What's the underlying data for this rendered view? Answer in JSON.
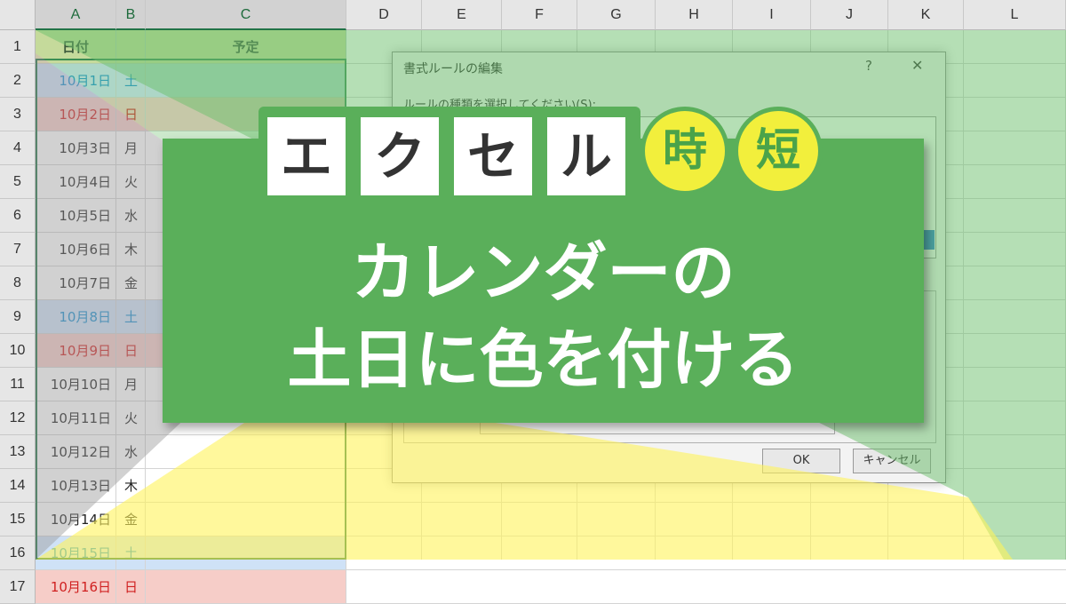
{
  "columns": [
    "A",
    "B",
    "C",
    "D",
    "E",
    "F",
    "G",
    "H",
    "I",
    "J",
    "K",
    "L"
  ],
  "rows": [
    "1",
    "2",
    "3",
    "4",
    "5",
    "6",
    "7",
    "8",
    "9",
    "10",
    "11",
    "12",
    "13",
    "14",
    "15",
    "16",
    "17"
  ],
  "header_row": {
    "date": "日付",
    "plan": "予定"
  },
  "calendar": [
    {
      "date": "10月1日",
      "day": "土",
      "type": "sat"
    },
    {
      "date": "10月2日",
      "day": "日",
      "type": "sun"
    },
    {
      "date": "10月3日",
      "day": "月",
      "type": "weekday"
    },
    {
      "date": "10月4日",
      "day": "火",
      "type": "weekday"
    },
    {
      "date": "10月5日",
      "day": "水",
      "type": "weekday"
    },
    {
      "date": "10月6日",
      "day": "木",
      "type": "weekday"
    },
    {
      "date": "10月7日",
      "day": "金",
      "type": "weekday"
    },
    {
      "date": "10月8日",
      "day": "土",
      "type": "sat"
    },
    {
      "date": "10月9日",
      "day": "日",
      "type": "sun"
    },
    {
      "date": "10月10日",
      "day": "月",
      "type": "weekday"
    },
    {
      "date": "10月11日",
      "day": "火",
      "type": "weekday"
    },
    {
      "date": "10月12日",
      "day": "水",
      "type": "weekday"
    },
    {
      "date": "10月13日",
      "day": "木",
      "type": "weekday"
    },
    {
      "date": "10月14日",
      "day": "金",
      "type": "weekday"
    },
    {
      "date": "10月15日",
      "day": "土",
      "type": "sat"
    },
    {
      "date": "10月16日",
      "day": "日",
      "type": "sun"
    }
  ],
  "dialog": {
    "title": "書式ルールの編集",
    "help": "?",
    "close": "✕",
    "rule_label": "ルールの種類を選択してください(S):",
    "ok": "OK",
    "cancel": "キャンセル"
  },
  "banner": {
    "brand": [
      "エ",
      "ク",
      "セ",
      "ル"
    ],
    "badges": [
      "時",
      "短"
    ],
    "line1": "カレンダーの",
    "line2": "土日に色を付ける"
  },
  "colors": {
    "banner_green": "#5aaf5a",
    "badge_yellow": "#f2ef3c",
    "overlay_green": "#6cbf6c",
    "overlay_yellow": "#fff45a",
    "saturday_fill": "#cfe2f7",
    "sunday_fill": "#f6cdc8",
    "saturday_text": "#1a8fd0",
    "sunday_text": "#d02020"
  }
}
